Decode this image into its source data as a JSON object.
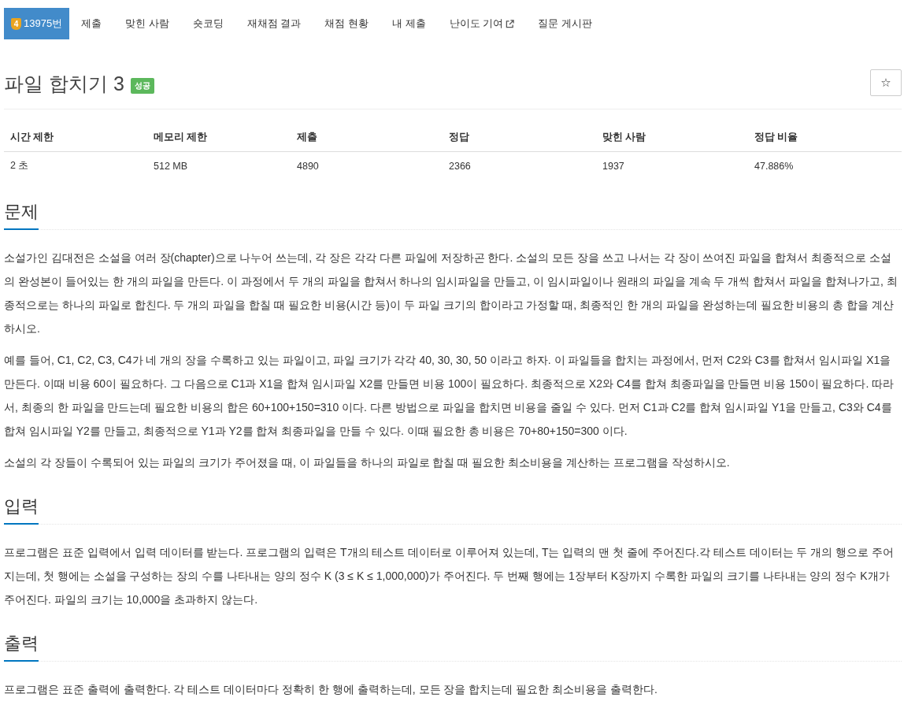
{
  "problem_nav": {
    "tabs": [
      {
        "label": "13975번",
        "badge": "4",
        "selected": true,
        "external": false
      },
      {
        "label": "제출",
        "selected": false,
        "external": false
      },
      {
        "label": "맞힌 사람",
        "selected": false,
        "external": false
      },
      {
        "label": "숏코딩",
        "selected": false,
        "external": false
      },
      {
        "label": "재채점 결과",
        "selected": false,
        "external": false
      },
      {
        "label": "채점 현황",
        "selected": false,
        "external": false
      },
      {
        "label": "내 제출",
        "selected": false,
        "external": false
      },
      {
        "label": "난이도 기여",
        "selected": false,
        "external": true
      },
      {
        "label": "질문 게시판",
        "selected": false,
        "external": false
      }
    ]
  },
  "problem": {
    "title": "파일 합치기 3",
    "status_badge": "성공",
    "favorite_button": "☆"
  },
  "info_table": {
    "columns": [
      "시간 제한",
      "메모리 제한",
      "제출",
      "정답",
      "맞힌 사람",
      "정답 비율"
    ],
    "rows": [
      [
        "2 초",
        "512 MB",
        "4890",
        "2366",
        "1937",
        "47.886%"
      ]
    ]
  },
  "sections": [
    {
      "heading": "문제",
      "paragraphs": [
        "소설가인 김대전은 소설을 여러 장(chapter)으로 나누어 쓰는데, 각 장은 각각 다른 파일에 저장하곤 한다. 소설의 모든 장을 쓰고 나서는 각 장이 쓰여진 파일을 합쳐서 최종적으로 소설의 완성본이 들어있는 한 개의 파일을 만든다. 이 과정에서 두 개의 파일을 합쳐서 하나의 임시파일을 만들고, 이 임시파일이나 원래의 파일을 계속 두 개씩 합쳐서 파일을 합쳐나가고, 최종적으로는 하나의 파일로 합친다. 두 개의 파일을 합칠 때 필요한 비용(시간 등)이 두 파일 크기의 합이라고 가정할 때, 최종적인 한 개의 파일을 완성하는데 필요한 비용의 총 합을 계산하시오.",
        "예를 들어, C1, C2, C3, C4가 네 개의 장을 수록하고 있는 파일이고, 파일 크기가 각각 40, 30, 30, 50 이라고 하자. 이 파일들을 합치는 과정에서, 먼저 C2와 C3를 합쳐서 임시파일 X1을 만든다. 이때 비용 60이 필요하다. 그 다음으로 C1과 X1을 합쳐 임시파일 X2를 만들면 비용 100이 필요하다. 최종적으로 X2와 C4를 합쳐 최종파일을 만들면 비용 150이 필요하다. 따라서, 최종의 한 파일을 만드는데 필요한 비용의 합은 60+100+150=310 이다. 다른 방법으로 파일을 합치면 비용을 줄일 수 있다. 먼저 C1과 C2를 합쳐 임시파일 Y1을 만들고, C3와 C4를 합쳐 임시파일 Y2를 만들고, 최종적으로 Y1과 Y2를 합쳐 최종파일을 만들 수 있다. 이때 필요한 총 비용은 70+80+150=300 이다.",
        "소설의 각 장들이 수록되어 있는 파일의 크기가 주어졌을 때, 이 파일들을 하나의 파일로 합칠 때 필요한 최소비용을 계산하는 프로그램을 작성하시오."
      ]
    },
    {
      "heading": "입력",
      "paragraphs": [
        "프로그램은 표준 입력에서 입력 데이터를 받는다. 프로그램의 입력은 T개의 테스트 데이터로 이루어져 있는데, T는 입력의 맨 첫 줄에 주어진다.각 테스트 데이터는 두 개의 행으로 주어지는데, 첫 행에는 소설을 구성하는 장의 수를 나타내는 양의 정수 K (3 ≤ K ≤ 1,000,000)가 주어진다. 두 번째 행에는 1장부터 K장까지 수록한 파일의 크기를 나타내는 양의 정수 K개가 주어진다. 파일의 크기는 10,000을 초과하지 않는다."
      ]
    },
    {
      "heading": "출력",
      "paragraphs": [
        "프로그램은 표준 출력에 출력한다. 각 테스트 데이터마다 정확히 한 행에 출력하는데, 모든 장을 합치는데 필요한 최소비용을 출력한다."
      ]
    }
  ]
}
